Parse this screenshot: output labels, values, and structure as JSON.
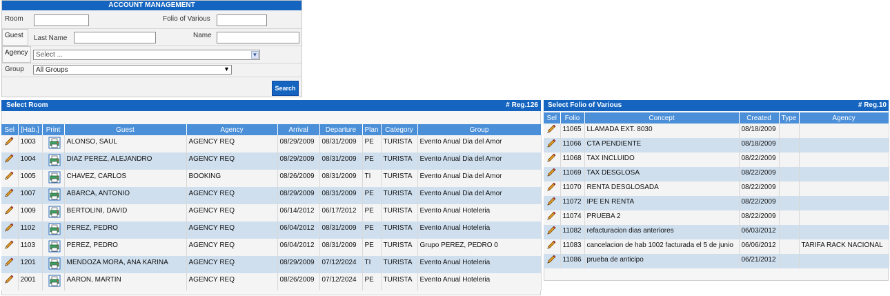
{
  "account": {
    "title": "ACCOUNT MANAGEMENT",
    "room_label": "Room",
    "room_value": "",
    "folio_label": "Folio of Various",
    "folio_value": "",
    "guest_label": "Guest",
    "last_name_label": "Last Name",
    "last_name_value": "",
    "name_label": "Name",
    "name_value": "",
    "agency_label": "Agency",
    "agency_selected": "Select ...",
    "group_label": "Group",
    "group_selected": "All Groups",
    "search_label": "Search"
  },
  "room_panel": {
    "title": "Select Room",
    "count": "# Reg.126",
    "columns": [
      "Sel",
      "[Hab.]",
      "Print",
      "Guest",
      "Agency",
      "Arrival",
      "Departure",
      "Plan",
      "Category",
      "Group"
    ],
    "rows": [
      {
        "hab": "1003",
        "guest": "ALONSO, SAUL",
        "agency": "AGENCY REQ",
        "arrival": "08/29/2009",
        "departure": "08/31/2009",
        "plan": "PE",
        "category": "TURISTA",
        "group": "Evento Anual Dia del Amor"
      },
      {
        "hab": "1004",
        "guest": "DIAZ PEREZ, ALEJANDRO",
        "agency": "AGENCY REQ",
        "arrival": "08/29/2009",
        "departure": "08/31/2009",
        "plan": "PE",
        "category": "TURISTA",
        "group": "Evento Anual Dia del Amor"
      },
      {
        "hab": "1005",
        "guest": "CHAVEZ, CARLOS",
        "agency": "BOOKING",
        "arrival": "08/26/2009",
        "departure": "08/31/2009",
        "plan": "TI",
        "category": "TURISTA",
        "group": "Evento Anual Dia del Amor"
      },
      {
        "hab": "1007",
        "guest": "ABARCA, ANTONIO",
        "agency": "AGENCY REQ",
        "arrival": "08/29/2009",
        "departure": "08/31/2009",
        "plan": "PE",
        "category": "TURISTA",
        "group": "Evento Anual Dia del Amor"
      },
      {
        "hab": "1009",
        "guest": "BERTOLINI, DAVID",
        "agency": "AGENCY REQ",
        "arrival": "06/14/2012",
        "departure": "06/17/2012",
        "plan": "PE",
        "category": "TURISTA",
        "group": "Evento Anual Hoteleria"
      },
      {
        "hab": "1102",
        "guest": "PEREZ, PEDRO",
        "agency": "AGENCY REQ",
        "arrival": "06/04/2012",
        "departure": "08/31/2009",
        "plan": "PE",
        "category": "TURISTA",
        "group": "Evento Anual Hoteleria"
      },
      {
        "hab": "1103",
        "guest": "PEREZ, PEDRO",
        "agency": "AGENCY REQ",
        "arrival": "06/04/2012",
        "departure": "08/31/2009",
        "plan": "PE",
        "category": "TURISTA",
        "group": "Grupo PEREZ, PEDRO 0"
      },
      {
        "hab": "1201",
        "guest": "MENDOZA MORA, ANA KARINA",
        "agency": "AGENCY REQ",
        "arrival": "08/29/2009",
        "departure": "07/12/2024",
        "plan": "TI",
        "category": "TURISTA",
        "group": "Evento Anual Hoteleria"
      },
      {
        "hab": "2001",
        "guest": "AARON, MARTIN",
        "agency": "AGENCY REQ",
        "arrival": "08/26/2009",
        "departure": "07/12/2024",
        "plan": "PE",
        "category": "TURISTA",
        "group": "Evento Anual Hoteleria"
      }
    ]
  },
  "folio_panel": {
    "title": "Select Folio of Various",
    "count": "# Reg.10",
    "columns": [
      "Sel",
      "Folio",
      "Concept",
      "Created",
      "Type",
      "Agency"
    ],
    "rows": [
      {
        "folio": "11065",
        "concept": "LLAMADA EXT. 8030",
        "created": "08/18/2009",
        "type": "",
        "agency": ""
      },
      {
        "folio": "11066",
        "concept": "CTA PENDIENTE",
        "created": "08/18/2009",
        "type": "",
        "agency": ""
      },
      {
        "folio": "11068",
        "concept": "TAX INCLUIDO",
        "created": "08/22/2009",
        "type": "",
        "agency": ""
      },
      {
        "folio": "11069",
        "concept": "TAX DESGLOSA",
        "created": "08/22/2009",
        "type": "",
        "agency": ""
      },
      {
        "folio": "11070",
        "concept": "RENTA DESGLOSADA",
        "created": "08/22/2009",
        "type": "",
        "agency": ""
      },
      {
        "folio": "11072",
        "concept": "IPE EN RENTA",
        "created": "08/22/2009",
        "type": "",
        "agency": ""
      },
      {
        "folio": "11074",
        "concept": "PRUEBA 2",
        "created": "08/22/2009",
        "type": "",
        "agency": ""
      },
      {
        "folio": "11082",
        "concept": "refacturacion dias anteriores",
        "created": "06/03/2012",
        "type": "",
        "agency": ""
      },
      {
        "folio": "11083",
        "concept": "cancelacion de hab 1002 facturada el 5 de junio",
        "created": "06/06/2012",
        "type": "",
        "agency": "TARIFA RACK NACIONAL"
      },
      {
        "folio": "11086",
        "concept": "prueba de anticipo",
        "created": "06/21/2012",
        "type": "",
        "agency": ""
      }
    ]
  },
  "icons": {
    "select": "pencil-icon",
    "print": "print-icon"
  },
  "colors": {
    "header": "#1565c0",
    "column_header": "#4a8fd8",
    "row_alt": "#cfdfee"
  }
}
